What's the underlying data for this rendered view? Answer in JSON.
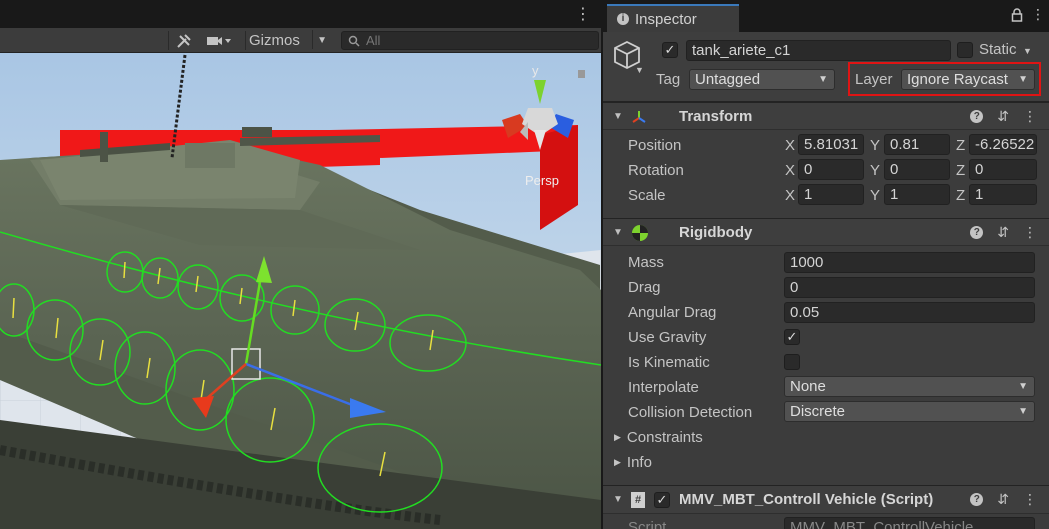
{
  "scene": {
    "gizmos_label": "Gizmos",
    "search_placeholder": "All",
    "persp_label": "Persp",
    "axis_y_label": "y"
  },
  "inspector": {
    "tab_label": "Inspector",
    "object": {
      "name": "tank_ariete_c1",
      "active": true,
      "static_label": "Static",
      "tag_label": "Tag",
      "tag_value": "Untagged",
      "layer_label": "Layer",
      "layer_value": "Ignore Raycast",
      "highlight_color": "#e01414"
    },
    "transform": {
      "title": "Transform",
      "position_label": "Position",
      "rotation_label": "Rotation",
      "scale_label": "Scale",
      "position": {
        "x": "5.81031",
        "y": "0.81",
        "z": "-6.26522"
      },
      "rotation": {
        "x": "0",
        "y": "0",
        "z": "0"
      },
      "scale": {
        "x": "1",
        "y": "1",
        "z": "1"
      },
      "axis_x": "X",
      "axis_y": "Y",
      "axis_z": "Z"
    },
    "rigidbody": {
      "title": "Rigidbody",
      "mass_label": "Mass",
      "mass": "1000",
      "drag_label": "Drag",
      "drag": "0",
      "angular_drag_label": "Angular Drag",
      "angular_drag": "0.05",
      "use_gravity_label": "Use Gravity",
      "use_gravity": true,
      "is_kinematic_label": "Is Kinematic",
      "is_kinematic": false,
      "interpolate_label": "Interpolate",
      "interpolate": "None",
      "collision_label": "Collision Detection",
      "collision": "Discrete",
      "constraints_label": "Constraints",
      "info_label": "Info"
    },
    "script_component": {
      "title": "MMV_MBT_Controll Vehicle (Script)",
      "script_label": "Script",
      "script_value": "MMV_MBT_ControllVehicle"
    }
  }
}
